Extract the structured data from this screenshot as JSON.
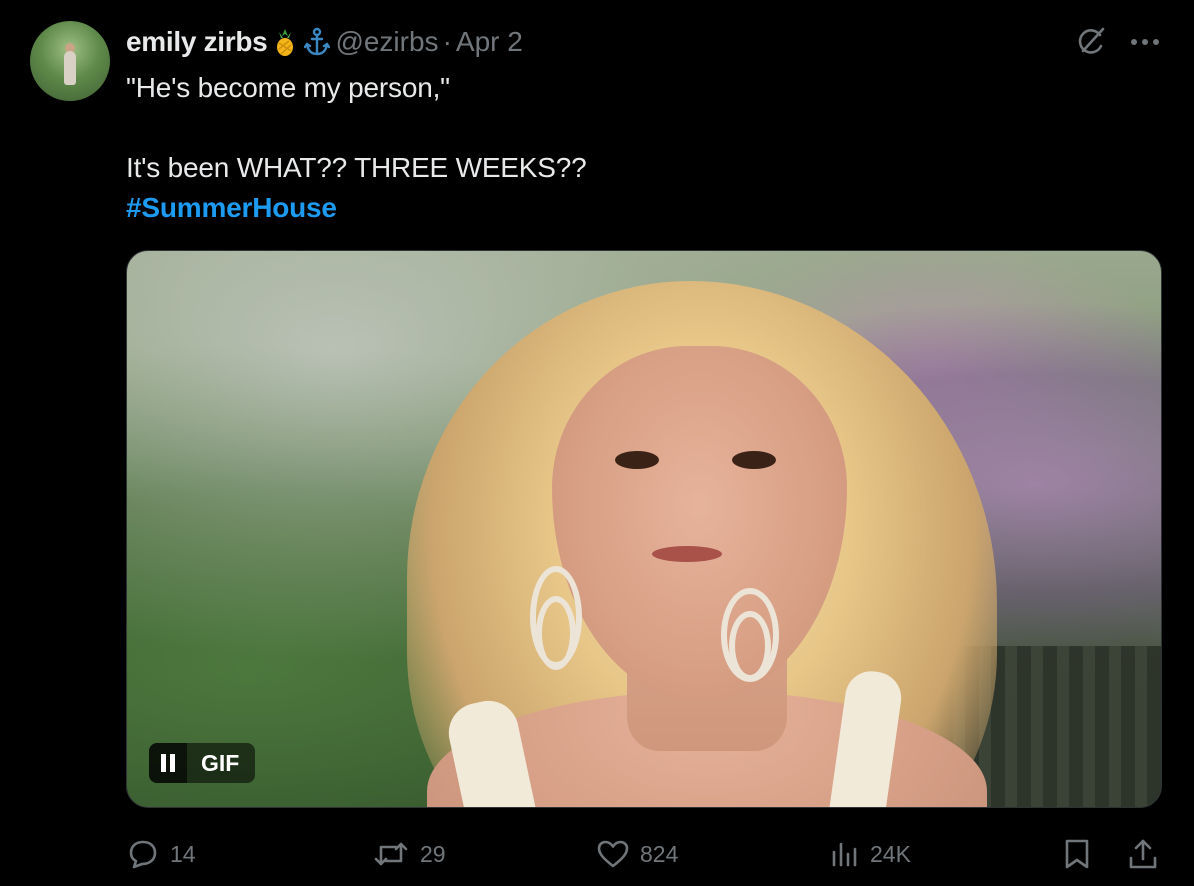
{
  "tweet": {
    "author_name": "emily zirbs",
    "author_emoji_1": "pineapple",
    "author_emoji_2": "anchor",
    "handle": "@ezirbs",
    "separator": "·",
    "date": "Apr 2",
    "text_line_1": "\"He's become my person,\"",
    "text_line_2": "It's been WHAT?? THREE WEEKS??",
    "hashtag": "#SummerHouse"
  },
  "media": {
    "badge_label": "GIF",
    "playback_state": "playing"
  },
  "actions": {
    "replies": "14",
    "reposts": "29",
    "likes": "824",
    "views": "24K"
  },
  "colors": {
    "background": "#000000",
    "text": "#e7e9ea",
    "muted": "#71767b",
    "accent": "#1d9bf0"
  },
  "icons": [
    "grok-icon",
    "more-icon",
    "reply-icon",
    "repost-icon",
    "like-icon",
    "views-icon",
    "bookmark-icon",
    "share-icon",
    "pause-icon"
  ]
}
